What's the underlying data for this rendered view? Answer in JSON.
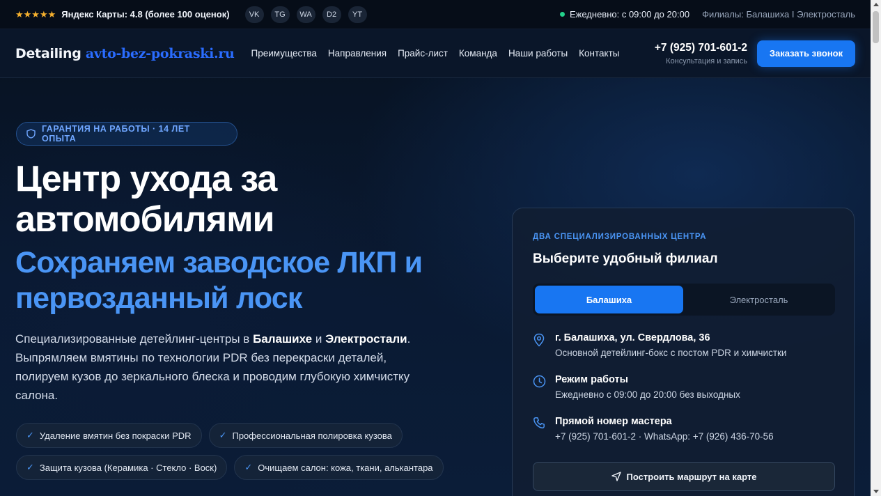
{
  "topbar": {
    "stars": "★★★★★",
    "rating": "Яндекс Карты: 4.8 (более 100 оценок)",
    "socials": [
      "VK",
      "TG",
      "WA",
      "D2",
      "YT"
    ],
    "schedule": "Ежедневно: с 09:00 до 20:00",
    "branches": "Филиалы: Балашиха I Электросталь"
  },
  "header": {
    "logo_part1": "Detailing ",
    "logo_part2": "avto-bez-pokraski.ru",
    "nav": [
      "Преимущества",
      "Направления",
      "Прайс-лист",
      "Команда",
      "Наши работы",
      "Контакты"
    ],
    "phone": "+7 (925) 701-601-2",
    "phone_sub": "Консультация и запись",
    "callback_label": "Заказать звонок"
  },
  "hero": {
    "badge": "ГАРАНТИЯ НА РАБОТЫ · 14 ЛЕТ ОПЫТА",
    "title": "Центр ухода за автомобилями",
    "subtitle": "Сохраняем заводское ЛКП и первозданный лоск",
    "lead_1": "Специализированные детейлинг-центры в ",
    "lead_city1": "Балашихе",
    "lead_and": " и ",
    "lead_city2": "Электростали",
    "lead_2": ". Выпрямляем вмятины по технологии PDR без перекраски деталей, полируем кузов до зеркального блеска и проводим глубокую химчистку салона.",
    "chips": [
      "Удаление вмятин без покраски PDR",
      "Профессиональная полировка кузова",
      "Защита кузова (Керамика · Стекло · Воск)",
      "Очищаем салон: кожа, ткани, алькантара"
    ]
  },
  "card": {
    "eyebrow": "ДВА СПЕЦИАЛИЗИРОВАННЫХ ЦЕНТРА",
    "title": "Выберите удобный филиал",
    "tabs": [
      "Балашиха",
      "Электросталь"
    ],
    "address_title": "г. Балашиха, ул. Свердлова, 36",
    "address_sub": "Основной детейлинг-бокс с постом PDR и химчистки",
    "hours_title": "Режим работы",
    "hours_sub": "Ежедневно с 09:00 до 20:00 без выходных",
    "phone_title": "Прямой номер мастера",
    "phone_sub": "+7 (925) 701-601-2 · WhatsApp: +7 (926) 436-70-56",
    "route_label": "Построить маршрут на карте"
  },
  "colors": {
    "accent": "#1876f2",
    "accent_text": "#4a95f5",
    "stars": "#f5b02e",
    "online": "#23d18b"
  }
}
